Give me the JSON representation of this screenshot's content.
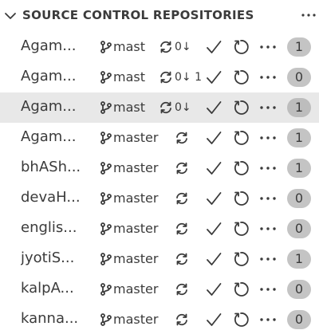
{
  "panel": {
    "title": "SOURCE CONTROL REPOSITORIES",
    "collapse_icon": "chevron-down-icon",
    "more_icon": "ellipsis-icon"
  },
  "icons": {
    "branch": "git-branch-icon",
    "sync": "sync-icon",
    "commit": "check-icon",
    "refresh": "refresh-icon",
    "more": "ellipsis-icon"
  },
  "colors": {
    "badge_bg": "#c4c4c4",
    "selected_row_bg": "#e8e8e8",
    "text": "#3b3b3b"
  },
  "repositories": [
    {
      "name": "Agam...",
      "branch": "mast",
      "sync": "0↓",
      "changes": "1",
      "selected": false
    },
    {
      "name": "Agam...",
      "branch": "mast",
      "sync": "0↓ 1",
      "changes": "0",
      "selected": false
    },
    {
      "name": "Agam...",
      "branch": "mast",
      "sync": "0↓",
      "changes": "1",
      "selected": true
    },
    {
      "name": "Agam...",
      "branch": "master",
      "sync": "",
      "changes": "1",
      "selected": false
    },
    {
      "name": "bhASh...",
      "branch": "master",
      "sync": "",
      "changes": "1",
      "selected": false
    },
    {
      "name": "devaH...",
      "branch": "master",
      "sync": "",
      "changes": "0",
      "selected": false
    },
    {
      "name": "englis...",
      "branch": "master",
      "sync": "",
      "changes": "0",
      "selected": false
    },
    {
      "name": "jyotiS...",
      "branch": "master",
      "sync": "",
      "changes": "1",
      "selected": false
    },
    {
      "name": "kalpA...",
      "branch": "master",
      "sync": "",
      "changes": "0",
      "selected": false
    },
    {
      "name": "kanna...",
      "branch": "master",
      "sync": "",
      "changes": "0",
      "selected": false
    }
  ]
}
